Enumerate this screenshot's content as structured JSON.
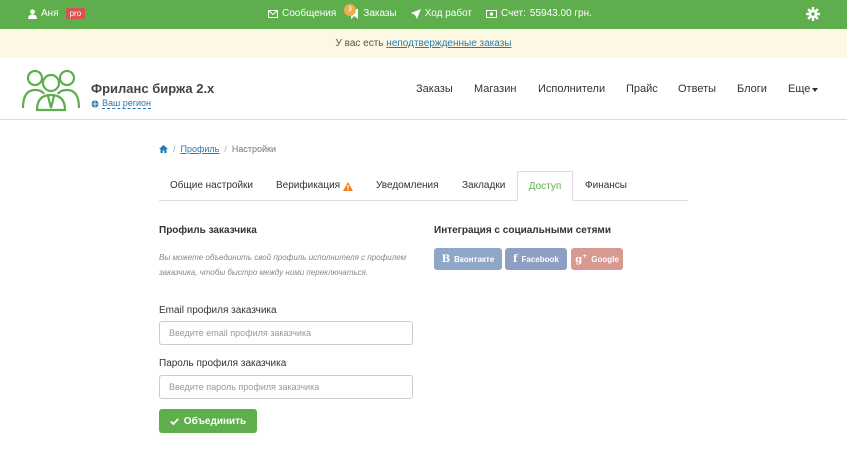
{
  "topbar": {
    "user_name": "Аня",
    "pro_badge": "pro",
    "messages": "Сообщения",
    "orders": "Заказы",
    "orders_badge": "3",
    "work_progress": "Ход работ",
    "account": "Счет:",
    "account_value": "55943.00 грн.",
    "bg_color": "#5fae4e"
  },
  "notice": {
    "text": "У вас есть ",
    "link": "неподтвержденные заказы"
  },
  "header": {
    "brand": "Фриланс биржа 2.x",
    "region": "Ваш регион",
    "nav": [
      "Заказы",
      "Магазин",
      "Исполнители",
      "Прайс",
      "Ответы",
      "Блоги",
      "Еще"
    ]
  },
  "breadcrumb": {
    "home_icon": "home-icon",
    "profile": "Профиль",
    "current": "Настройки"
  },
  "tabs": [
    {
      "label": "Общие настройки"
    },
    {
      "label": "Верификация"
    },
    {
      "label": "Уведомления"
    },
    {
      "label": "Закладки"
    },
    {
      "label": "Доступ"
    },
    {
      "label": "Финансы"
    }
  ],
  "customer_profile": {
    "title": "Профиль заказчика",
    "hint": "Вы можете объединить свой профиль исполнителя с профилем заказчика, чтобы быстро между ними переключаться.",
    "email_label": "Email профиля заказчика",
    "email_placeholder": "Введите email профиля заказчика",
    "password_label": "Пароль профиля заказчика",
    "password_placeholder": "Введите пароль профиля заказчика",
    "merge_button": "Объединить"
  },
  "social": {
    "title": "Интеграция с социальными сетями",
    "vk": "Вконтакте",
    "facebook": "Facebook",
    "google": "Google",
    "vk_color": "#8fa8c8",
    "fb_color": "#8e9fc3",
    "google_color": "#d89a90"
  }
}
